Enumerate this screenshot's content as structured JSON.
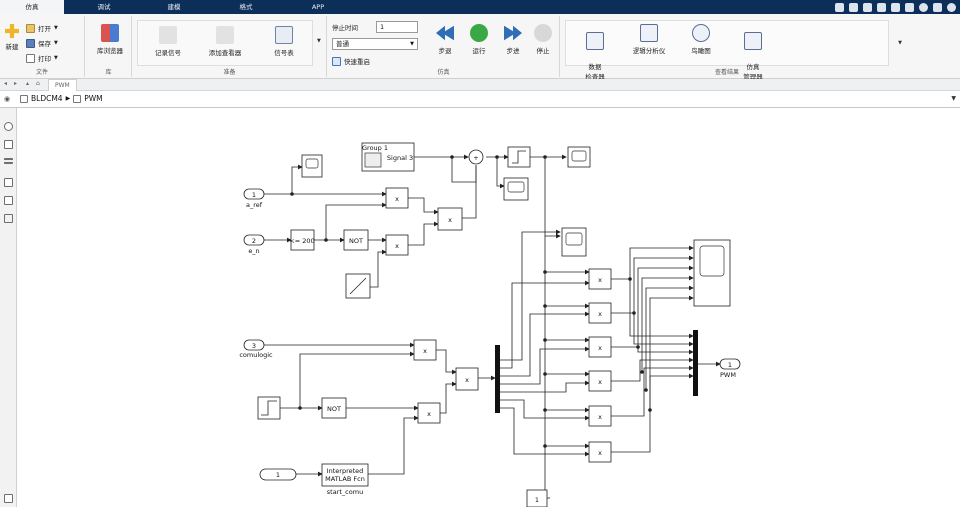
{
  "tabs": [
    {
      "label": "仿真",
      "active": true
    },
    {
      "label": "调试"
    },
    {
      "label": "建模"
    },
    {
      "label": "格式"
    },
    {
      "label": "APP"
    }
  ],
  "ribbon": {
    "file": {
      "new": "新建",
      "open": "打开",
      "save": "保存",
      "print": "打印",
      "group": "文件"
    },
    "library": {
      "browser": "库浏览器",
      "group": "库"
    },
    "prepare": {
      "log_signals": "记录信号",
      "add_viewer": "添加查看器",
      "signal_table": "信号表",
      "group": "准备"
    },
    "simulate": {
      "stop_time_label": "停止时间",
      "stop_time_value": "1",
      "mode": "普通",
      "fast_restart": "快速重启",
      "step_back": "步退",
      "run": "运行",
      "step_forward": "步进",
      "stop": "停止",
      "group": "仿真"
    },
    "review": {
      "data_inspector": "数据\n检查器",
      "logic_analyzer": "逻辑分析仪",
      "bird_eye": "鸟瞰图",
      "sim_manager": "仿真\n管理器",
      "group": "查看结果"
    }
  },
  "navbar": {
    "tab": "PWM"
  },
  "breadcrumb": {
    "root": "BLDCM4",
    "child": "PWM"
  },
  "diagram": {
    "inputs": {
      "in1": {
        "port": "1",
        "label": "a_ref"
      },
      "in2": {
        "port": "2",
        "label": "e_n"
      },
      "in3": {
        "port": "3",
        "label": "comulogic"
      },
      "in4": {
        "port": "1"
      }
    },
    "blocks": {
      "group1_title": "Group 1",
      "group1_signal": "Signal 3",
      "compare": "<= 200",
      "not1": "NOT",
      "not2": "NOT",
      "mult": "x",
      "sum_plus": "+",
      "fcn_line1": "Interpreted",
      "fcn_line2": "MATLAB Fcn",
      "fcn_label": "start_comu",
      "constant": "1"
    },
    "output": {
      "port": "1",
      "label": "PWM"
    }
  }
}
